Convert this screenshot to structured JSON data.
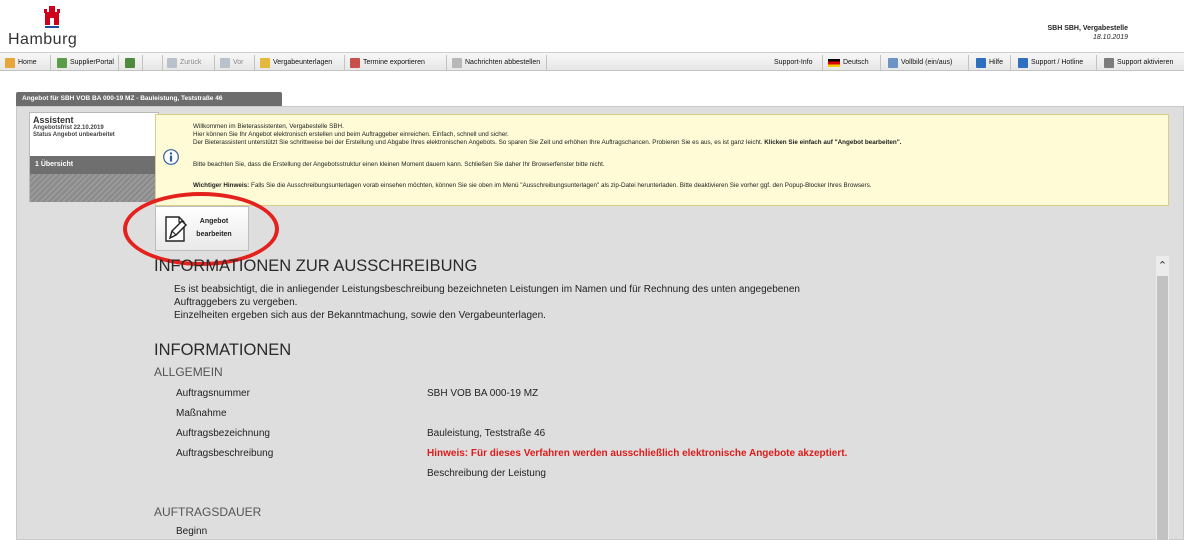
{
  "header": {
    "city": "Hamburg",
    "user": "SBH SBH, Vergabestelle",
    "date": "18.10.2019"
  },
  "toolbar": {
    "home": "Home",
    "supplier_portal": "SupplierPortal",
    "back": "Zurück",
    "forward": "Vor",
    "tender_docs": "Vergabeunterlagen",
    "export_dates": "Termine exportieren",
    "unsubscribe": "Nachrichten abbestellen",
    "support_info": "Support-Info",
    "language": "Deutsch",
    "fullscreen": "Vollbild (ein/aus)",
    "help": "Hilfe",
    "hotline": "Support / Hotline",
    "activate_support": "Support aktivieren"
  },
  "tab": {
    "label": "Angebot für SBH VOB BA 000-19 MZ - Bauleistung, Teststraße 46"
  },
  "assistant": {
    "title": "Assistent",
    "deadline": "Angebotsfrist 22.10.2019",
    "status": "Status Angebot unbearbeitet",
    "nav_item": "1  Übersicht"
  },
  "info": {
    "welcome": "Willkommen im Bieterassistenten, Vergabestelle SBH.",
    "line2": "Hier können Sie Ihr Angebot elektronisch erstellen und beim Auftraggeber einreichen. Einfach, schnell und sicher.",
    "line3_pre": "Der Bieterassistent unterstützt Sie schrittweise bei der Erstellung und Abgabe Ihres elektronischen Angebots. So sparen Sie Zeit und erhöhen Ihre Auftragschancen. Probieren Sie es aus, es ist ganz leicht. ",
    "line3_bold": "Klicken Sie einfach auf \"Angebot bearbeiten\".",
    "line4": "Bitte beachten Sie, dass die Erstellung der Angebotsstruktur einen kleinen Moment dauern kann. Schließen Sie daher Ihr Browserfenster bitte nicht.",
    "hint_label": "Wichtiger Hinweis:",
    "hint_text": " Falls Sie die Ausschreibungsunterlagen vorab einsehen möchten, können Sie sie oben im Menü \"Ausschreibungsunterlagen\" als zip-Datei herunterladen. Bitte deaktivieren Sie vorher ggf. den Popup-Blocker Ihres Browsers."
  },
  "edit_button": {
    "line1": "Angebot",
    "line2": "bearbeiten"
  },
  "content": {
    "section1_title": "INFORMATIONEN ZUR AUSSCHREIBUNG",
    "para1": "Es ist beabsichtigt, die in anliegender Leistungsbeschreibung bezeichneten Leistungen im Namen und für Rechnung des unten angegebenen",
    "para2": "Auftraggebers zu vergeben.",
    "para3": "Einzelheiten ergeben sich aus der Bekanntmachung, sowie den Vergabeunterlagen.",
    "section2_title": "INFORMATIONEN",
    "general_title": "ALLGEMEIN",
    "rows": [
      {
        "label": "Auftragsnummer",
        "value": "SBH VOB BA 000-19 MZ"
      },
      {
        "label": "Maßnahme",
        "value": ""
      },
      {
        "label": "Auftragsbezeichnung",
        "value": "Bauleistung, Teststraße 46"
      },
      {
        "label": "Auftragsbeschreibung",
        "value": "Hinweis: Für dieses Verfahren werden ausschließlich elektronische Angebote akzeptiert."
      },
      {
        "label": "",
        "value": "Beschreibung der Leistung"
      }
    ],
    "duration_title": "AUFTRAGSDAUER",
    "begin_label": "Beginn"
  },
  "colors": {
    "alert": "#dd1b1b",
    "highlight_ring": "#e5211d",
    "info_bg": "#fefbd6",
    "panel_bg": "#dedede"
  }
}
